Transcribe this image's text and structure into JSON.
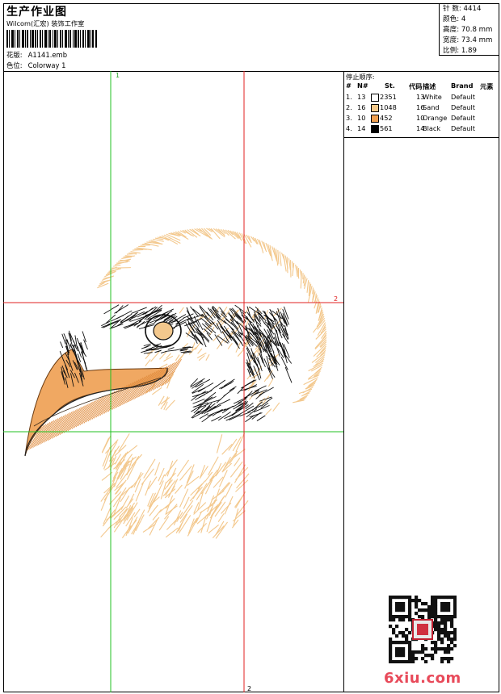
{
  "header": {
    "title": "生产作业图",
    "subtitle": "Wilcom(汇宏) 装饰工作室",
    "design_label": "花版:",
    "design_value": "A1141.emb",
    "colorway_label": "色位:",
    "colorway_value": "Colorway 1"
  },
  "stats": {
    "stitches": "针 数: 4414",
    "colors": "颜色: 4",
    "height": "高度: 70.8 mm",
    "width": "宽度: 73.4 mm",
    "scale": "比例: 1.89"
  },
  "guides": {
    "vertical_green_label": "1",
    "horizontal_red_label": "2",
    "vertical_red_label": "2"
  },
  "stop_sequence": {
    "title": "停止顺序:",
    "headers": [
      "#",
      "N#",
      "St.",
      "代码",
      "描述",
      "Brand",
      "元素"
    ],
    "rows": [
      {
        "idx": "1.",
        "n": "13",
        "st": "2351",
        "code": "13",
        "desc": "White",
        "brand": "Default",
        "color": "#ffffff"
      },
      {
        "idx": "2.",
        "n": "16",
        "st": "1048",
        "code": "16",
        "desc": "Sand",
        "brand": "Default",
        "color": "#f5c98a"
      },
      {
        "idx": "3.",
        "n": "10",
        "st": "452",
        "code": "10",
        "desc": "Orange",
        "brand": "Default",
        "color": "#f0a050"
      },
      {
        "idx": "4.",
        "n": "14",
        "st": "561",
        "code": "14",
        "desc": "Black",
        "brand": "Default",
        "color": "#000000"
      }
    ]
  },
  "watermark": "6xiu.com",
  "colors": {
    "sand_stitch": "#f3c88d",
    "orange_fill": "#f0a862",
    "black_stitch": "#111111",
    "guide_red": "#e02020",
    "guide_green": "#20c020"
  }
}
